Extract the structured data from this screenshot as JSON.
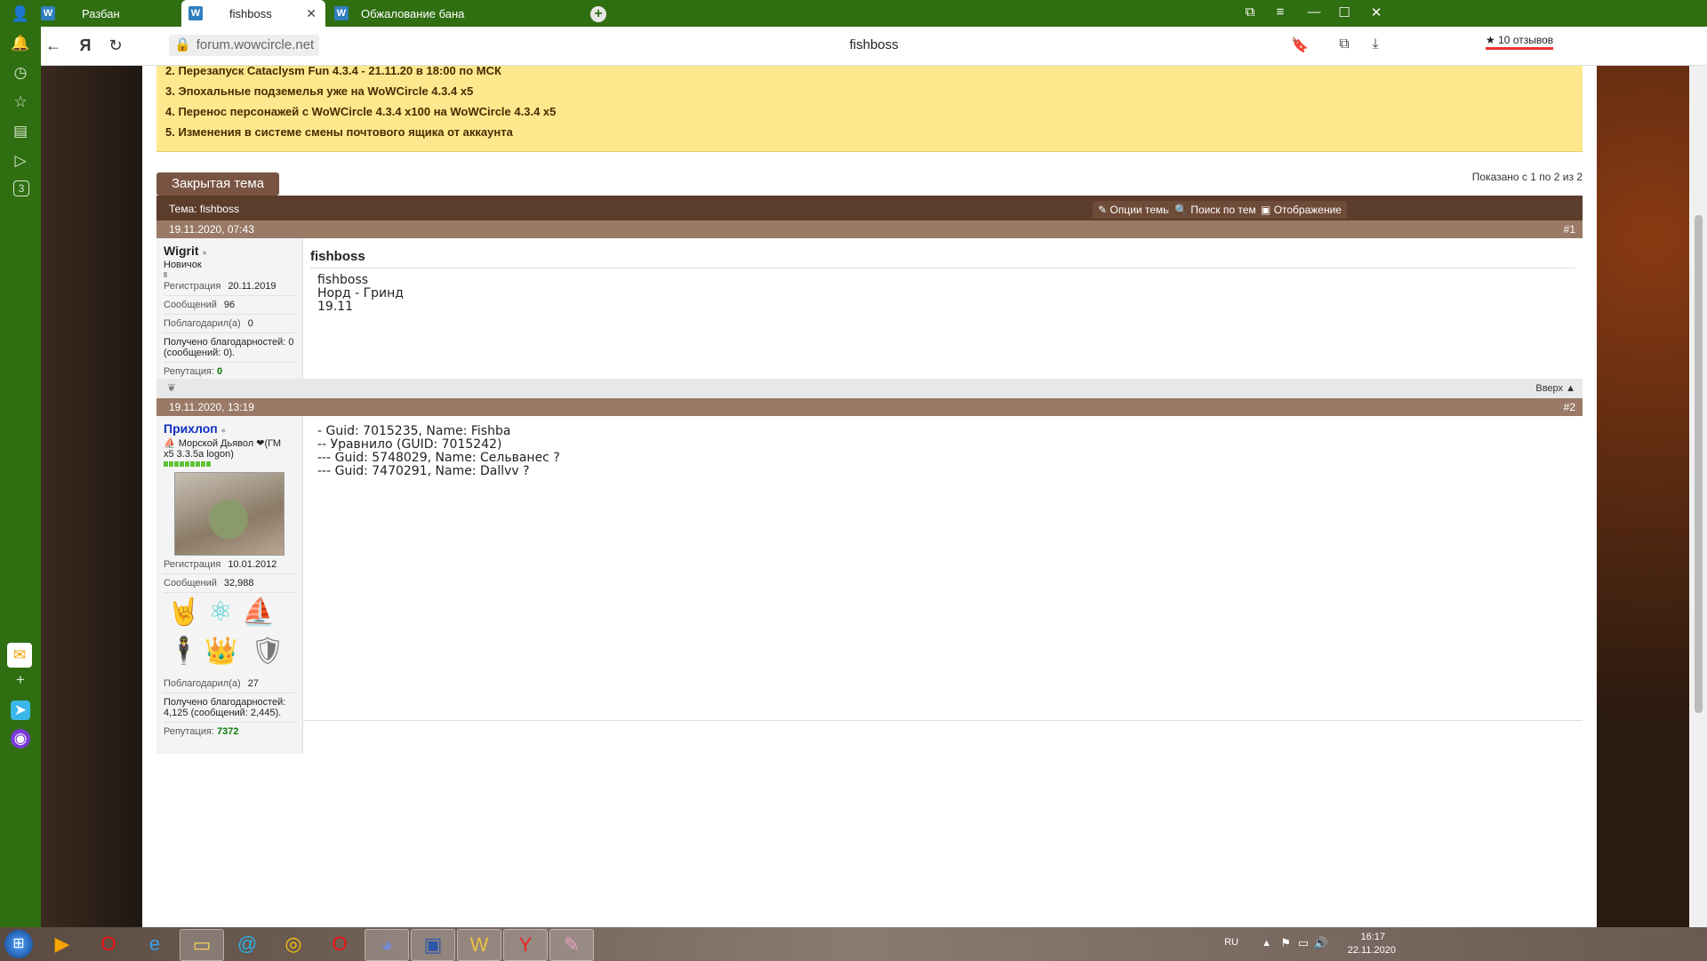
{
  "browser": {
    "tabs": [
      {
        "label": "Разбан",
        "active": false
      },
      {
        "label": "fishboss",
        "active": true
      },
      {
        "label": "Обжалование бана",
        "active": false
      }
    ],
    "url": "forum.wowcircle.net",
    "page_title": "fishboss",
    "reviews": "10 отзывов",
    "side_badge": "3"
  },
  "announcements": [
    "2. Перезапуск Cataclysm Fun 4.3.4 - 21.11.20 в 18:00 по МСК",
    "3. Эпохальные подземелья уже на WoWCircle 4.3.4 x5",
    "4. Перенос персонажей с WoWCircle 4.3.4 x100 на WoWCircle 4.3.4 x5",
    "5. Изменения в системе смены почтового ящика от аккаунта"
  ],
  "thread": {
    "closed_label": "Закрытая тема",
    "shown": "Показано с 1 по 2 из 2",
    "title": "Тема: fishboss",
    "tools": [
      "Опции темы",
      "Поиск по теме",
      "Отображение"
    ]
  },
  "posts": [
    {
      "date": "19.11.2020, 07:43",
      "num": "#1",
      "user": "Wigrit",
      "user_title": "Новичок",
      "reg_label": "Регистрация",
      "reg": "20.11.2019",
      "msgs_label": "Сообщений",
      "msgs": "96",
      "thanked_label": "Поблагодарил(а)",
      "thanked": "0",
      "thanks_received": "Получено благодарностей: 0 (сообщений: 0).",
      "rep_label": "Репутация:",
      "rep": "0",
      "heading": "fishboss",
      "text": "fishboss\nНорд - Гринд\n19.11",
      "top_link": "Вверх ▲"
    },
    {
      "date": "19.11.2020, 13:19",
      "num": "#2",
      "user": "Прихлоп",
      "user_title": "Морской Дьявол ❤(ГМ x5 3.3.5a logon)",
      "reg_label": "Регистрация",
      "reg": "10.01.2012",
      "msgs_label": "Сообщений",
      "msgs": "32,988",
      "thanked_label": "Поблагодарил(а)",
      "thanked": "27",
      "thanks_received": "Получено благодарностей: 4,125 (сообщений: 2,445).",
      "rep_label": "Репутация:",
      "rep": "7372",
      "text": "- Guid: 7015235, Name: Fishba\n-- Уравнило (GUID: 7015242)\n--- Guid: 5748029, Name: Сельванес ?\n--- Guid: 7470291, Name: Dallvv ?"
    }
  ],
  "taskbar": {
    "lang": "RU",
    "time": "16:17",
    "date": "22.11.2020"
  }
}
